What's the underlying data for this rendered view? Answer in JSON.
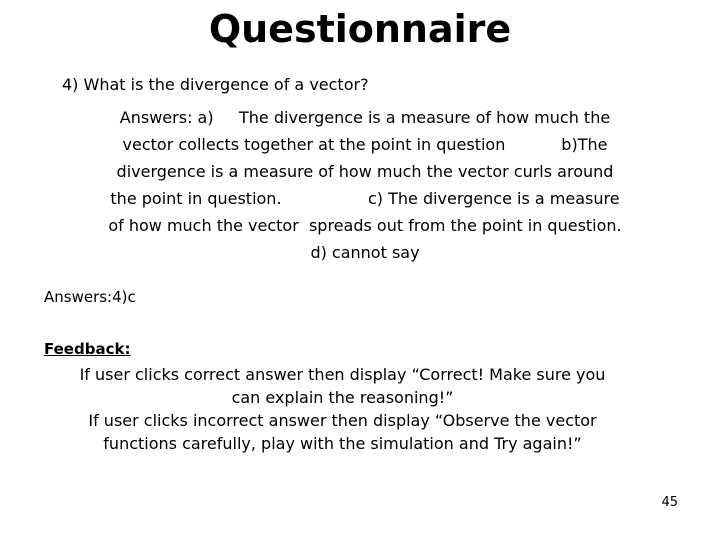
{
  "slide": {
    "title": "Questionnaire",
    "question": "4) What is the divergence of a vector?",
    "answers_lines": [
      "Answers: a)     The divergence is a measure of how much the",
      "vector collects together at the point in question           b)The",
      "divergence is a measure of how much the vector curls around",
      "the point in question.                 c) The divergence is a measure",
      "of how much the vector  spreads out from the point in question.",
      "d) cannot say"
    ],
    "answer_key": "Answers:4)c",
    "feedback_heading": "Feedback:",
    "feedback_lines": [
      "If user clicks correct answer then display “Correct! Make sure you",
      "can explain the reasoning!”",
      "If user clicks incorrect answer then display “Observe the vector",
      "functions carefully, play with the simulation and Try again!”"
    ],
    "page_number": "45",
    "colors": {
      "background": "#ffffff",
      "text": "#000000"
    }
  }
}
